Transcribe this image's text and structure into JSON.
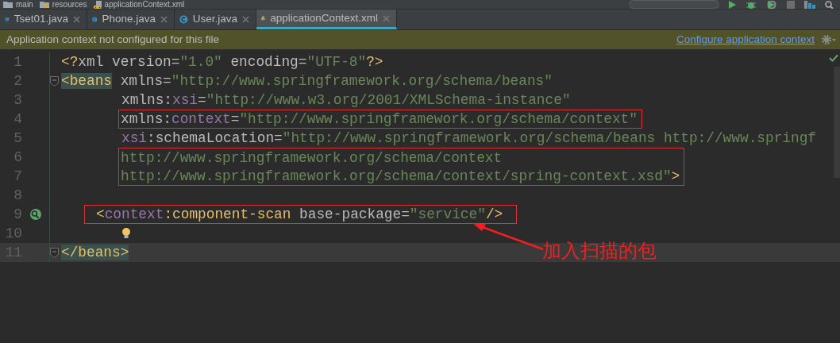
{
  "breadcrumb": [
    {
      "kind": "folder",
      "label": "main"
    },
    {
      "kind": "resources",
      "label": "resources"
    },
    {
      "kind": "xml",
      "label": "applicationContext.xml"
    }
  ],
  "tabs": [
    {
      "kind": "runnable",
      "label": "Tset01.java",
      "selected": false
    },
    {
      "kind": "class",
      "label": "Phone.java",
      "selected": false
    },
    {
      "kind": "class",
      "label": "User.java",
      "selected": false
    },
    {
      "kind": "xml",
      "label": "applicationContext.xml",
      "selected": true
    }
  ],
  "banner": {
    "message": "Application context not configured for this file",
    "link": "Configure application context"
  },
  "editor": {
    "lines": [
      {
        "number": "1",
        "kind": "top",
        "boxed": false,
        "fold": false,
        "current": false,
        "gutter_icon": false,
        "bulb": false,
        "tokens": [
          {
            "kind": "tag",
            "text": "<?"
          },
          {
            "kind": "attr",
            "text": "xml version="
          },
          {
            "kind": "value",
            "text": "\"1.0\""
          },
          {
            "kind": "attr",
            "text": " encoding="
          },
          {
            "kind": "value",
            "text": "\"UTF-8\""
          },
          {
            "kind": "tag",
            "text": "?>"
          }
        ]
      },
      {
        "number": "2",
        "kind": "top",
        "boxed": false,
        "fold": true,
        "current": false,
        "gutter_icon": false,
        "bulb": false,
        "tokens": [
          {
            "kind": "tag_match",
            "text": "<beans"
          },
          {
            "kind": "attr",
            "text": " xmlns="
          },
          {
            "kind": "value",
            "text": "\"http://www.springframework.org/schema/beans\""
          }
        ]
      },
      {
        "number": "3",
        "kind": "attr",
        "boxed": false,
        "fold": false,
        "current": false,
        "gutter_icon": false,
        "bulb": false,
        "tokens": [
          {
            "kind": "attr",
            "text": "xmlns:"
          },
          {
            "kind": "ns",
            "text": "xsi"
          },
          {
            "kind": "attr",
            "text": "="
          },
          {
            "kind": "value",
            "text": "\"http://www.w3.org/2001/XMLSchema-instance\""
          }
        ]
      },
      {
        "number": "4",
        "kind": "attr",
        "boxed": true,
        "fold": false,
        "current": false,
        "gutter_icon": false,
        "bulb": false,
        "tokens": [
          {
            "kind": "attr",
            "text": "xmlns:"
          },
          {
            "kind": "ns",
            "text": "context"
          },
          {
            "kind": "attr",
            "text": "="
          },
          {
            "kind": "value",
            "text": "\"http://www.springframework.org/schema/context\""
          }
        ]
      },
      {
        "number": "5",
        "kind": "attr",
        "boxed": false,
        "fold": false,
        "current": false,
        "gutter_icon": false,
        "bulb": false,
        "tokens": [
          {
            "kind": "ns",
            "text": "xsi"
          },
          {
            "kind": "attr",
            "text": ":schemaLocation="
          },
          {
            "kind": "value",
            "text": "\"http://www.springframework.org/schema/beans http://www.springf"
          }
        ]
      },
      {
        "number": "6",
        "kind": "attr",
        "boxed": true,
        "fold": false,
        "current": false,
        "gutter_icon": false,
        "bulb": false,
        "tokens": [
          {
            "kind": "value",
            "text": "http://www.springframework.org/schema/context"
          }
        ]
      },
      {
        "number": "7",
        "kind": "attr",
        "boxed": true,
        "fold": false,
        "current": false,
        "gutter_icon": false,
        "bulb": false,
        "tokens": [
          {
            "kind": "value",
            "text": "http://www.springframework.org/schema/context/spring-context.xsd\""
          },
          {
            "kind": "tag",
            "text": ">"
          }
        ]
      },
      {
        "number": "8",
        "kind": "top",
        "boxed": false,
        "fold": false,
        "current": false,
        "gutter_icon": false,
        "bulb": false
      },
      {
        "number": "9",
        "kind": "child",
        "boxed": true,
        "fold": false,
        "current": false,
        "gutter_icon": true,
        "bulb": false,
        "tokens": [
          {
            "kind": "tag",
            "text": "<"
          },
          {
            "kind": "ns",
            "text": "context"
          },
          {
            "kind": "tag",
            "text": ":component-scan"
          },
          {
            "kind": "attr",
            "text": " base-package="
          },
          {
            "kind": "value",
            "text": "\"service\""
          },
          {
            "kind": "tag",
            "text": "/>"
          }
        ]
      },
      {
        "number": "10",
        "kind": "attr",
        "boxed": false,
        "fold": false,
        "current": false,
        "gutter_icon": false,
        "bulb": true
      },
      {
        "number": "11",
        "kind": "top",
        "boxed": false,
        "fold": true,
        "current": true,
        "gutter_icon": false,
        "bulb": false,
        "tokens": [
          {
            "kind": "tag_match",
            "text": "</beans>"
          }
        ]
      }
    ]
  },
  "callout": {
    "text": "加入扫描的包"
  }
}
